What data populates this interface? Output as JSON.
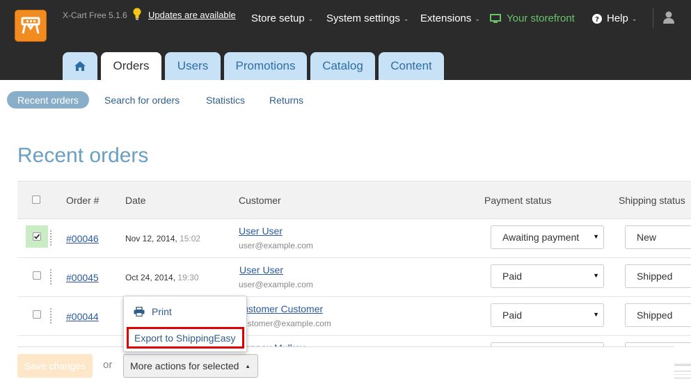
{
  "header": {
    "version": "X-Cart Free 5.1.6",
    "updates_link": "Updates are available",
    "nav": {
      "store_setup": "Store setup",
      "system_settings": "System settings",
      "extensions": "Extensions",
      "storefront": "Your storefront",
      "help": "Help"
    }
  },
  "tabs": [
    "Orders",
    "Users",
    "Promotions",
    "Catalog",
    "Content"
  ],
  "subnav": [
    "Recent orders",
    "Search for orders",
    "Statistics",
    "Returns"
  ],
  "page_title": "Recent orders",
  "table": {
    "headers": {
      "order": "Order #",
      "date": "Date",
      "customer": "Customer",
      "payment": "Payment status",
      "shipping": "Shipping status"
    },
    "rows": [
      {
        "order": "#00046",
        "date": "Nov 12, 2014,",
        "time": "15:02",
        "customer": "User User",
        "email": "user@example.com",
        "payment": "Awaiting payment",
        "shipping": "New",
        "checked": true
      },
      {
        "order": "#00045",
        "date": "Oct 24, 2014,",
        "time": "19:30",
        "customer": "User User",
        "email": "user@example.com",
        "payment": "Paid",
        "shipping": "Shipped",
        "checked": false
      },
      {
        "order": "#00044",
        "date": "",
        "time": "",
        "customer": "ustomer Customer",
        "email": "ustomer@example.com",
        "payment": "Paid",
        "shipping": "Shipped",
        "checked": false
      },
      {
        "order": "",
        "date": "",
        "time": "",
        "customer": "enney Mulkey",
        "email": "",
        "payment": "",
        "shipping": "",
        "checked": false
      }
    ]
  },
  "footer": {
    "save": "Save changes",
    "or": "or",
    "more_actions": "More actions for selected"
  },
  "menu": {
    "print": "Print",
    "export": "Export to ShippingEasy"
  },
  "colors": {
    "topbar": "#2b2b2b",
    "tab": "#c7e2f7",
    "accent": "#2e6da4",
    "highlight": "#e00000"
  }
}
